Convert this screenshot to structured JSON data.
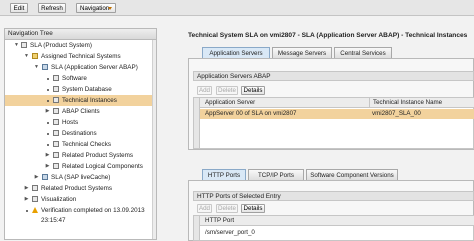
{
  "toolbar": {
    "edit": "Edit",
    "refresh": "Refresh",
    "navigation": "Navigation"
  },
  "nav": {
    "title": "Navigation Tree",
    "items": [
      {
        "label": "SLA (Product System)"
      },
      {
        "label": "Assigned Technical Systems"
      },
      {
        "label": "SLA (Application Server ABAP)"
      },
      {
        "label": "Software"
      },
      {
        "label": "System Database"
      },
      {
        "label": "Technical Instances"
      },
      {
        "label": "ABAP Clients"
      },
      {
        "label": "Hosts"
      },
      {
        "label": "Destinations"
      },
      {
        "label": "Technical Checks"
      },
      {
        "label": "Related Product Systems"
      },
      {
        "label": "Related Logical Components"
      },
      {
        "label": "SLA (SAP liveCache)"
      },
      {
        "label": "Related Product Systems"
      },
      {
        "label": "Visualization"
      },
      {
        "label": "Verification completed on 13.09.2013"
      },
      {
        "label": "23:15:47"
      }
    ]
  },
  "main": {
    "title": "Technical System SLA on vmi2807 - SLA (Application Server ABAP) - Technical Instances",
    "tabs": [
      {
        "label": "Application Servers"
      },
      {
        "label": "Message Servers"
      },
      {
        "label": "Central Services"
      }
    ],
    "app_servers": {
      "title": "Application Servers ABAP",
      "add": "Add",
      "delete": "Delete",
      "details": "Details",
      "columns": [
        "Application Server",
        "Technical Instance Name"
      ],
      "rows": [
        [
          "AppServer 00 of SLA on vmi2807",
          "vmi2807_SLA_00"
        ]
      ]
    },
    "bottom_tabs": [
      {
        "label": "HTTP Ports"
      },
      {
        "label": "TCP/IP Ports"
      },
      {
        "label": "Software Component Versions"
      }
    ],
    "http": {
      "title": "HTTP Ports of Selected Entry",
      "add": "Add",
      "delete": "Delete",
      "details": "Details",
      "column": "HTTP Port",
      "rows": [
        "/sm/server_port_0"
      ]
    }
  }
}
